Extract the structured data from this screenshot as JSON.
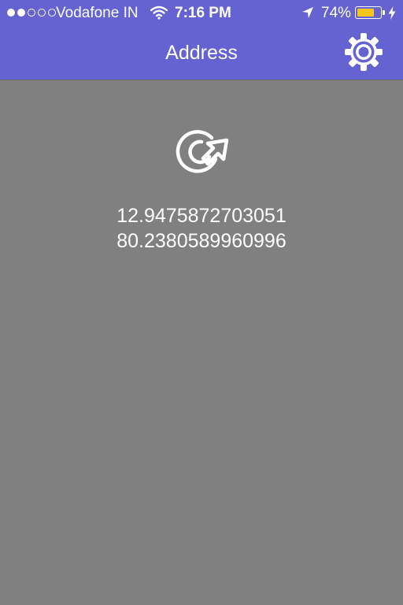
{
  "status_bar": {
    "signal_bars_filled": 2,
    "signal_bars_total": 5,
    "carrier": "Vodafone IN",
    "time": "7:16 PM",
    "battery_percent_label": "74%",
    "battery_level": 0.74,
    "icons": [
      "wifi-icon",
      "location-arrow-icon",
      "battery-icon",
      "charging-bolt-icon"
    ]
  },
  "header": {
    "title": "Address",
    "settings_icon": "gear-icon",
    "background_color": "#6463d1"
  },
  "main": {
    "refresh_icon": "refresh-icon",
    "latitude": "12.9475872703051",
    "longitude": "80.2380589960996",
    "background_color": "#808080"
  }
}
